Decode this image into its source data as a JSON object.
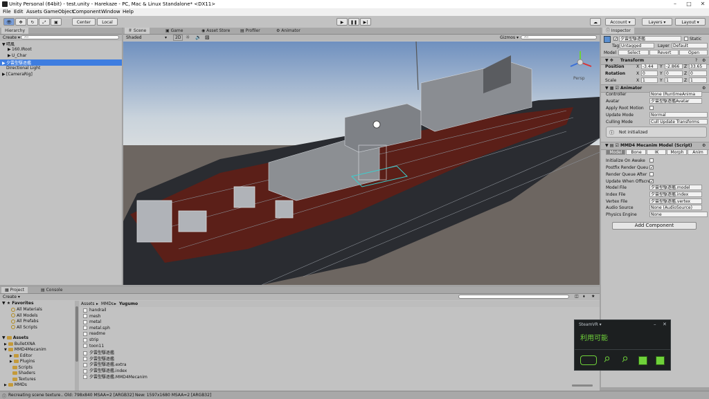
{
  "window": {
    "title": "Unity Personal (64bit) - test.unity - Harekaze - PC, Mac & Linux Standalone* <DX11>"
  },
  "menu": [
    "File",
    "Edit",
    "Assets",
    "GameObject",
    "Component",
    "Window",
    "Help"
  ],
  "toolbar": {
    "center": "Center",
    "local": "Local",
    "account": "Account",
    "layers": "Layers",
    "layout": "Layout"
  },
  "hierarchy": {
    "tab": "Hierarchy",
    "create": "Create",
    "search_placeholder": "All",
    "items": [
      {
        "label": "晴風",
        "depth": 0,
        "arrow": "▼"
      },
      {
        "label": "160.IRoot",
        "depth": 1,
        "arrow": "▶"
      },
      {
        "label": "U_Char",
        "depth": 1,
        "arrow": "▶"
      },
      {
        "label": "夕雲型駆逐艦",
        "depth": 0,
        "arrow": "▶",
        "selected": true
      },
      {
        "label": "Directional Light",
        "depth": 0,
        "arrow": ""
      },
      {
        "label": "[CameraRig]",
        "depth": 0,
        "arrow": "▶"
      }
    ]
  },
  "scene": {
    "tabs": [
      "Scene",
      "Game",
      "Asset Store",
      "Profiler",
      "Animator"
    ],
    "shading": "Shaded",
    "mode2d": "2D",
    "gizmos": "Gizmos",
    "search_placeholder": "All",
    "persp": "Persp"
  },
  "inspector": {
    "tab": "Inspector",
    "object_name": "夕雲型駆逐艦",
    "static_label": "Static",
    "tag_label": "Tag",
    "tag_value": "Untagged",
    "layer_label": "Layer",
    "layer_value": "Default",
    "model_label": "Model",
    "model_select": "Select",
    "model_revert": "Revert",
    "model_open": "Open",
    "transform": {
      "header": "Transform",
      "position_label": "Position",
      "rotation_label": "Rotation",
      "scale_label": "Scale",
      "position": {
        "x": "-3.44",
        "y": "-2.866",
        "z": "33.65"
      },
      "rotation": {
        "x": "0",
        "y": "0",
        "z": "0"
      },
      "scale": {
        "x": "1",
        "y": "1",
        "z": "1"
      }
    },
    "animator": {
      "header": "Animator",
      "controller_label": "Controller",
      "controller_value": "None (RuntimeAnima",
      "avatar_label": "Avatar",
      "avatar_value": "夕雲型駆逐艦Avatar",
      "apply_root_label": "Apply Root Motion",
      "update_mode_label": "Update Mode",
      "update_mode_value": "Normal",
      "culling_label": "Culling Mode",
      "culling_value": "Cull Update Transforms",
      "info": "Not initialized"
    },
    "mmd": {
      "header": "MMD4 Mecanim Model (Script)",
      "tabs": [
        "Model",
        "Bone",
        "IK",
        "Morph",
        "Anim"
      ],
      "init_label": "Initialize On Awake",
      "postfix_label": "Postfix Render Queu",
      "rq_after_label": "Render Queue After",
      "update_off_label": "Update When Offscre",
      "model_file_label": "Model File",
      "model_file_value": "夕雲型駆逐艦.model",
      "index_file_label": "Index File",
      "index_file_value": "夕雲型駆逐艦.index",
      "vertex_file_label": "Vertex File",
      "vertex_file_value": "夕雲型駆逐艦.vertex",
      "audio_label": "Audio Source",
      "audio_value": "None (AudioSource)",
      "physics_label": "Physics Engine",
      "physics_value": "None"
    },
    "add_component": "Add Component"
  },
  "project": {
    "tabs": [
      "Project",
      "Console"
    ],
    "create": "Create",
    "favorites_label": "Favorites",
    "favorites": [
      "All Materials",
      "All Models",
      "All Prefabs",
      "All Scripts"
    ],
    "assets_label": "Assets",
    "tree": [
      {
        "label": "BulletXNA",
        "depth": 1
      },
      {
        "label": "MMD4Mecanim",
        "depth": 1
      },
      {
        "label": "Editor",
        "depth": 2
      },
      {
        "label": "Plugins",
        "depth": 2
      },
      {
        "label": "Scripts",
        "depth": 2
      },
      {
        "label": "Shaders",
        "depth": 2
      },
      {
        "label": "Textures",
        "depth": 2
      },
      {
        "label": "MMDs",
        "depth": 1
      }
    ],
    "breadcrumb": [
      "Assets",
      "MMDs",
      "Yugumo"
    ],
    "files": [
      "handrail",
      "mesh",
      "metal",
      "metal.sph",
      "readme",
      "strip",
      "toon11",
      "夕雲型駆逐艦",
      "夕雲型駆逐艦",
      "夕雲型駆逐艦.extra",
      "夕雲型駆逐艦.index",
      "夕雲型駆逐艦.MMD4Mecanim"
    ]
  },
  "steamvr": {
    "title": "SteamVR",
    "status": "利用可能",
    "accent": "#6fd23a"
  },
  "statusbar": {
    "text": "Recreating scene texture.. Old: 798x840 MSAA=2 [ARGB32] New: 1597x1680 MSAA=2 [ARGB32]"
  }
}
